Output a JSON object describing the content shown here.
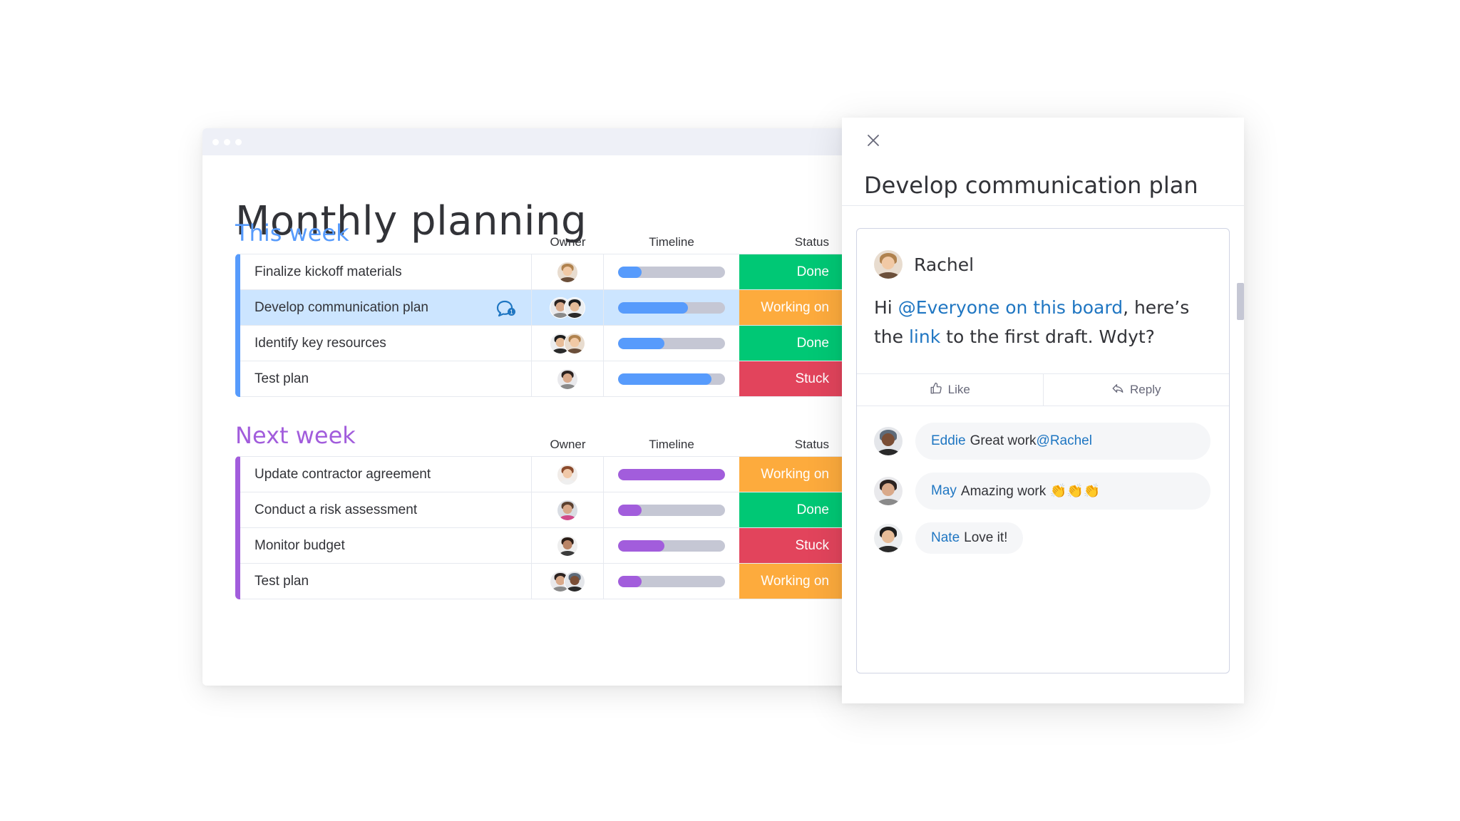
{
  "window": {
    "dots": 3
  },
  "board": {
    "title": "Monthly planning",
    "columns": {
      "owner": "Owner",
      "timeline": "Timeline",
      "status": "Status"
    },
    "status_colors": {
      "Done": "#00c875",
      "Working on it": "#fdab3d",
      "Stuck": "#e2445c"
    },
    "groups": [
      {
        "title": "This week",
        "color": "#579bfc",
        "rows": [
          {
            "name": "Finalize kickoff materials",
            "owners": [
              "woman-blonde"
            ],
            "timeline_progress": 0.22,
            "status": "Done",
            "status_label": "Done"
          },
          {
            "name": "Develop communication plan",
            "owners": [
              "woman-dark",
              "man-asian"
            ],
            "timeline_progress": 0.65,
            "status": "Working on it",
            "status_label": "Working on",
            "selected": true,
            "has_comment": true,
            "comment_count": "1"
          },
          {
            "name": "Identify key resources",
            "owners": [
              "man-asian",
              "woman-blonde"
            ],
            "timeline_progress": 0.43,
            "status": "Done",
            "status_label": "Done"
          },
          {
            "name": "Test plan",
            "owners": [
              "woman-dark"
            ],
            "timeline_progress": 0.87,
            "status": "Stuck",
            "status_label": "Stuck"
          }
        ]
      },
      {
        "title": "Next week",
        "color": "#a25ddc",
        "rows": [
          {
            "name": "Update contractor agreement",
            "owners": [
              "woman-red"
            ],
            "timeline_progress": 1.0,
            "status": "Working on it",
            "status_label": "Working on"
          },
          {
            "name": "Conduct a risk assessment",
            "owners": [
              "man-beard"
            ],
            "timeline_progress": 0.22,
            "status": "Done",
            "status_label": "Done"
          },
          {
            "name": "Monitor budget",
            "owners": [
              "woman-curly"
            ],
            "timeline_progress": 0.43,
            "status": "Stuck",
            "status_label": "Stuck"
          },
          {
            "name": "Test plan",
            "owners": [
              "woman-dark",
              "man-dark"
            ],
            "timeline_progress": 0.22,
            "status": "Working on it",
            "status_label": "Working on"
          }
        ]
      }
    ]
  },
  "panel": {
    "title": "Develop communication plan",
    "close_icon": "close-icon",
    "post": {
      "author": "Rachel",
      "body": [
        {
          "text": "Hi ",
          "mention": false
        },
        {
          "text": "@Everyone on this board",
          "mention": true
        },
        {
          "text": ", here’s the ",
          "mention": false
        },
        {
          "text": "link",
          "mention": true
        },
        {
          "text": " to the first draft. Wdyt?",
          "mention": false
        }
      ],
      "like_label": "Like",
      "reply_label": "Reply"
    },
    "replies": [
      {
        "author": "Eddie",
        "avatar": "man-dark",
        "parts": [
          {
            "text": "Great work ",
            "mention": false
          },
          {
            "text": "@Rachel",
            "mention": true
          }
        ]
      },
      {
        "author": "May",
        "avatar": "woman-dark",
        "parts": [
          {
            "text": "Amazing work 👏👏👏",
            "mention": false
          }
        ]
      },
      {
        "author": "Nate",
        "avatar": "man-asian",
        "parts": [
          {
            "text": "Love it!",
            "mention": false
          }
        ]
      }
    ]
  },
  "colors": {
    "accent": "#1f76c2",
    "selected_row": "#cce5ff",
    "track": "#c5c7d4"
  }
}
